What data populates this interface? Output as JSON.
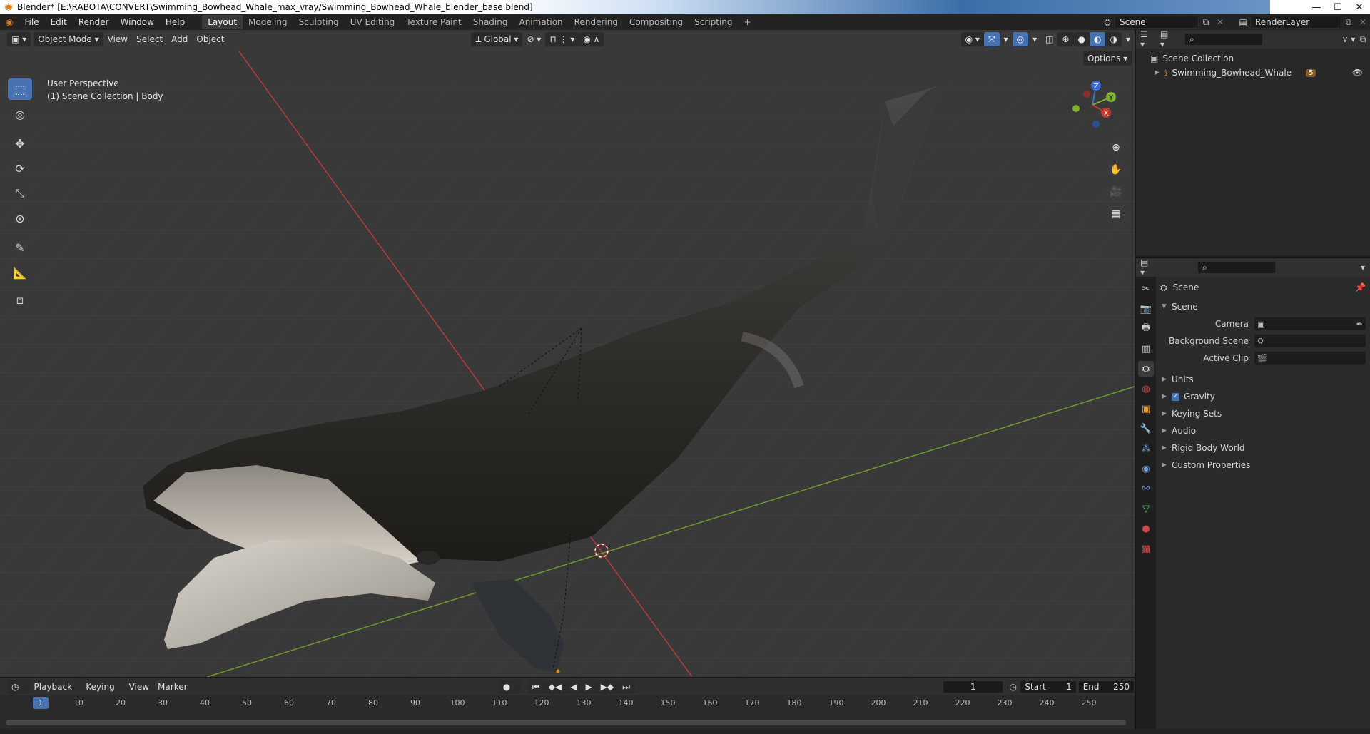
{
  "window": {
    "title": "Blender* [E:\\RABOTA\\CONVERT\\Swimming_Bowhead_Whale_max_vray/Swimming_Bowhead_Whale_blender_base.blend]"
  },
  "menu": {
    "items": [
      "File",
      "Edit",
      "Render",
      "Window",
      "Help"
    ]
  },
  "workspaces": {
    "tabs": [
      "Layout",
      "Modeling",
      "Sculpting",
      "UV Editing",
      "Texture Paint",
      "Shading",
      "Animation",
      "Rendering",
      "Compositing",
      "Scripting"
    ],
    "active": "Layout"
  },
  "top_right": {
    "scene_name": "Scene",
    "view_layer": "RenderLayer"
  },
  "viewport": {
    "mode": "Object Mode",
    "menus": [
      "View",
      "Select",
      "Add",
      "Object"
    ],
    "orientation": "Global",
    "options_label": "Options",
    "overlay_title": "User Perspective",
    "overlay_subtitle": "(1) Scene Collection | Body",
    "gizmo_axes": [
      "Z",
      "Y",
      "X"
    ]
  },
  "outliner": {
    "root": "Scene Collection",
    "items": [
      {
        "name": "Swimming_Bowhead_Whale",
        "badge": "5"
      }
    ]
  },
  "properties": {
    "context_title": "Scene",
    "section_title": "Scene",
    "fields": [
      {
        "label": "Camera",
        "value": ""
      },
      {
        "label": "Background Scene",
        "value": ""
      },
      {
        "label": "Active Clip",
        "value": ""
      }
    ],
    "panels": [
      {
        "label": "Units",
        "checkbox": false
      },
      {
        "label": "Gravity",
        "checkbox": true
      },
      {
        "label": "Keying Sets",
        "checkbox": false
      },
      {
        "label": "Audio",
        "checkbox": false
      },
      {
        "label": "Rigid Body World",
        "checkbox": false
      },
      {
        "label": "Custom Properties",
        "checkbox": false
      }
    ]
  },
  "timeline": {
    "menus": [
      "Playback",
      "Keying",
      "View",
      "Marker"
    ],
    "current_frame": "1",
    "start_label": "Start",
    "start_value": "1",
    "end_label": "End",
    "end_value": "250",
    "ruler": [
      "10",
      "20",
      "30",
      "40",
      "50",
      "60",
      "70",
      "80",
      "90",
      "100",
      "110",
      "120",
      "130",
      "140",
      "150",
      "160",
      "170",
      "180",
      "190",
      "200",
      "210",
      "220",
      "230",
      "240",
      "250"
    ],
    "ruler_current": "1"
  },
  "colors": {
    "accent": "#4772b3",
    "x_axis": "#c0392b",
    "y_axis": "#7fb235",
    "z_axis": "#3b6fd6",
    "viewport_bg": "#393939"
  }
}
